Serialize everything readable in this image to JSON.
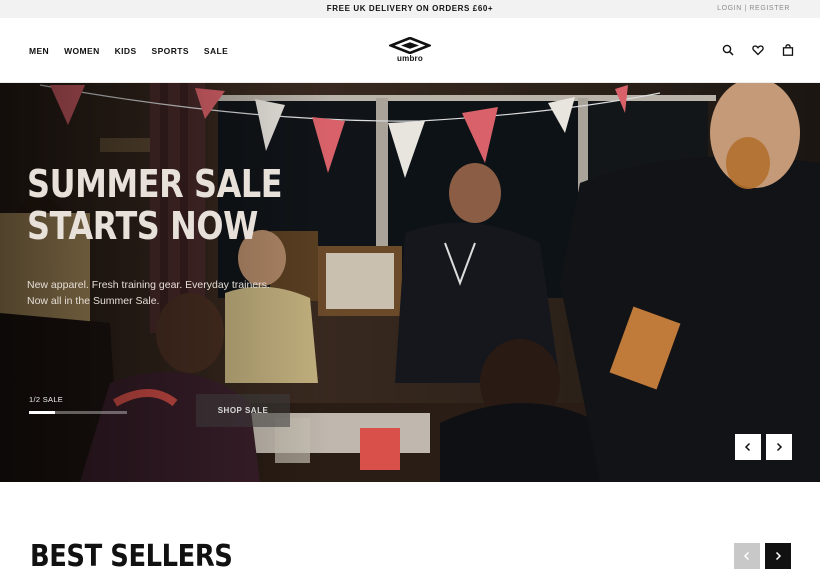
{
  "promo": {
    "text": "FREE UK DELIVERY ON ORDERS £60+"
  },
  "account": {
    "login": "LOGIN",
    "separator": " | ",
    "register": "REGISTER"
  },
  "nav": {
    "items": [
      "MEN",
      "WOMEN",
      "KIDS",
      "SPORTS",
      "SALE"
    ]
  },
  "logo": {
    "word": "umbro"
  },
  "header_icons": [
    "search-icon",
    "heart-icon",
    "bag-icon"
  ],
  "hero": {
    "title_line1": "SUMMER SALE",
    "title_line2": "STARTS NOW",
    "subtitle_line1": "New apparel. Fresh training gear. Everyday trainers.",
    "subtitle_line2": "Now all in the Summer Sale.",
    "slide_label": "1/2 SALE",
    "cta": "SHOP SALE",
    "slide_progress": 0.27
  },
  "best_sellers": {
    "title": "BEST SELLERS"
  },
  "colors": {
    "accent": "#111111",
    "promo_bg": "#f2f2f2",
    "bunting_red": "#d9626a",
    "bunting_white": "#e8e4de"
  }
}
